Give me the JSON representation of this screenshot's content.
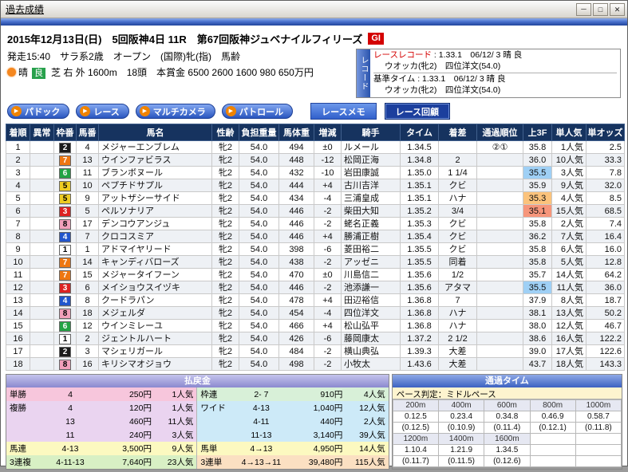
{
  "window": {
    "title": "過去成績",
    "minimize": "－",
    "maximize": "□",
    "close": "✕"
  },
  "icons": {
    "play": "▶"
  },
  "race": {
    "title": "2015年12月13日(日)　5回阪神4日 11R　第67回阪神ジュベナイルフィリーズ",
    "grade": "GI",
    "conditions": "発走15:40　サラ系2歳　オープン　(国際)牝(指)　馬齢",
    "weather": "晴",
    "going": "良",
    "course": "芝 右 外 1600m　18頭　本賞金 6500 2600 1600 980 650万円",
    "record": {
      "tab": "レコード",
      "race_record_label": "レースレコード",
      "race_record_value": " : 1.33.1　06/12/ 3 晴 良",
      "race_record_holder": "ウオッカ(牝2)　四位洋文(54.0)",
      "base_time_label": "基準タイム",
      "base_time_value": " : 1.33.1　06/12/ 3 晴 良",
      "base_time_holder": "ウオッカ(牝2)　四位洋文(54.0)"
    }
  },
  "buttons": {
    "paddock": "パドック",
    "race": "レース",
    "multi_camera": "マルチカメラ",
    "patrol": "パトロール",
    "race_memo": "レースメモ",
    "race_review": "レース回顧"
  },
  "waku_colors": {
    "1": {
      "bg": "#ffffff",
      "fg": "#000000"
    },
    "2": {
      "bg": "#1a1a1a",
      "fg": "#ffffff"
    },
    "3": {
      "bg": "#dd2222",
      "fg": "#ffffff"
    },
    "4": {
      "bg": "#2255cc",
      "fg": "#ffffff"
    },
    "5": {
      "bg": "#eecc22",
      "fg": "#000000"
    },
    "6": {
      "bg": "#22a344",
      "fg": "#ffffff"
    },
    "7": {
      "bg": "#ee7711",
      "fg": "#ffffff"
    },
    "8": {
      "bg": "#f2a0bb",
      "fg": "#000000"
    }
  },
  "results": {
    "headers": [
      "着順",
      "異常",
      "枠番",
      "馬番",
      "馬名",
      "性齢",
      "負担重量",
      "馬体重",
      "増減",
      "騎手",
      "タイム",
      "着差",
      "通過順位",
      "上3F",
      "単人気",
      "単オッズ"
    ],
    "rows": [
      {
        "pos": "1",
        "abnormal": "",
        "waku": "2",
        "num": "4",
        "name": "メジャーエンブレム",
        "sex_age": "牝2",
        "weight": "54.0",
        "horse_weight": "494",
        "weight_diff": "±0",
        "jockey": "ルメール",
        "time": "1.34.5",
        "margin": "",
        "passing": "②①",
        "last3f": "35.8",
        "last3f_hl": 0,
        "pop": "1人気",
        "odds": "2.5"
      },
      {
        "pos": "2",
        "abnormal": "",
        "waku": "7",
        "num": "13",
        "name": "ウインファビラス",
        "sex_age": "牝2",
        "weight": "54.0",
        "horse_weight": "448",
        "weight_diff": "-12",
        "jockey": "松岡正海",
        "time": "1.34.8",
        "margin": "2",
        "passing": "",
        "last3f": "36.0",
        "last3f_hl": 0,
        "pop": "10人気",
        "odds": "33.3"
      },
      {
        "pos": "3",
        "abnormal": "",
        "waku": "6",
        "num": "11",
        "name": "ブランボヌール",
        "sex_age": "牝2",
        "weight": "54.0",
        "horse_weight": "432",
        "weight_diff": "-10",
        "jockey": "岩田康誠",
        "time": "1.35.0",
        "margin": "1 1/4",
        "passing": "",
        "last3f": "35.5",
        "last3f_hl": 3,
        "pop": "3人気",
        "odds": "7.8"
      },
      {
        "pos": "4",
        "abnormal": "",
        "waku": "5",
        "num": "10",
        "name": "ペプチドサプル",
        "sex_age": "牝2",
        "weight": "54.0",
        "horse_weight": "444",
        "weight_diff": "+4",
        "jockey": "古川吉洋",
        "time": "1.35.1",
        "margin": "クビ",
        "passing": "",
        "last3f": "35.9",
        "last3f_hl": 0,
        "pop": "9人気",
        "odds": "32.0"
      },
      {
        "pos": "5",
        "abnormal": "",
        "waku": "5",
        "num": "9",
        "name": "アットザシーサイド",
        "sex_age": "牝2",
        "weight": "54.0",
        "horse_weight": "434",
        "weight_diff": "-4",
        "jockey": "三浦皇成",
        "time": "1.35.1",
        "margin": "ハナ",
        "passing": "",
        "last3f": "35.3",
        "last3f_hl": 2,
        "pop": "4人気",
        "odds": "8.5"
      },
      {
        "pos": "6",
        "abnormal": "",
        "waku": "3",
        "num": "5",
        "name": "ペルソナリア",
        "sex_age": "牝2",
        "weight": "54.0",
        "horse_weight": "446",
        "weight_diff": "-2",
        "jockey": "柴田大知",
        "time": "1.35.2",
        "margin": "3/4",
        "passing": "",
        "last3f": "35.1",
        "last3f_hl": 1,
        "pop": "15人気",
        "odds": "68.5"
      },
      {
        "pos": "7",
        "abnormal": "",
        "waku": "8",
        "num": "17",
        "name": "デンコウアンジュ",
        "sex_age": "牝2",
        "weight": "54.0",
        "horse_weight": "446",
        "weight_diff": "-2",
        "jockey": "蛯名正義",
        "time": "1.35.3",
        "margin": "クビ",
        "passing": "",
        "last3f": "35.8",
        "last3f_hl": 0,
        "pop": "2人気",
        "odds": "7.4"
      },
      {
        "pos": "8",
        "abnormal": "",
        "waku": "4",
        "num": "7",
        "name": "クロコスミア",
        "sex_age": "牝2",
        "weight": "54.0",
        "horse_weight": "446",
        "weight_diff": "+4",
        "jockey": "勝浦正樹",
        "time": "1.35.4",
        "margin": "クビ",
        "passing": "",
        "last3f": "36.2",
        "last3f_hl": 0,
        "pop": "7人気",
        "odds": "16.4"
      },
      {
        "pos": "9",
        "abnormal": "",
        "waku": "1",
        "num": "1",
        "name": "アドマイヤリード",
        "sex_age": "牝2",
        "weight": "54.0",
        "horse_weight": "398",
        "weight_diff": "-6",
        "jockey": "菱田裕二",
        "time": "1.35.5",
        "margin": "クビ",
        "passing": "",
        "last3f": "35.8",
        "last3f_hl": 0,
        "pop": "6人気",
        "odds": "16.0"
      },
      {
        "pos": "10",
        "abnormal": "",
        "waku": "7",
        "num": "14",
        "name": "キャンディバローズ",
        "sex_age": "牝2",
        "weight": "54.0",
        "horse_weight": "438",
        "weight_diff": "-2",
        "jockey": "アッゼニ",
        "time": "1.35.5",
        "margin": "同着",
        "passing": "",
        "last3f": "35.8",
        "last3f_hl": 0,
        "pop": "5人気",
        "odds": "12.8"
      },
      {
        "pos": "11",
        "abnormal": "",
        "waku": "7",
        "num": "15",
        "name": "メジャータイフーン",
        "sex_age": "牝2",
        "weight": "54.0",
        "horse_weight": "470",
        "weight_diff": "±0",
        "jockey": "川島信二",
        "time": "1.35.6",
        "margin": "1/2",
        "passing": "",
        "last3f": "35.7",
        "last3f_hl": 0,
        "pop": "14人気",
        "odds": "64.2"
      },
      {
        "pos": "12",
        "abnormal": "",
        "waku": "3",
        "num": "6",
        "name": "メイショウスイヅキ",
        "sex_age": "牝2",
        "weight": "54.0",
        "horse_weight": "446",
        "weight_diff": "-2",
        "jockey": "池添謙一",
        "time": "1.35.6",
        "margin": "アタマ",
        "passing": "",
        "last3f": "35.5",
        "last3f_hl": 3,
        "pop": "11人気",
        "odds": "36.0"
      },
      {
        "pos": "13",
        "abnormal": "",
        "waku": "4",
        "num": "8",
        "name": "クードラパン",
        "sex_age": "牝2",
        "weight": "54.0",
        "horse_weight": "478",
        "weight_diff": "+4",
        "jockey": "田辺裕信",
        "time": "1.36.8",
        "margin": "7",
        "passing": "",
        "last3f": "37.9",
        "last3f_hl": 0,
        "pop": "8人気",
        "odds": "18.7"
      },
      {
        "pos": "14",
        "abnormal": "",
        "waku": "8",
        "num": "18",
        "name": "メジェルダ",
        "sex_age": "牝2",
        "weight": "54.0",
        "horse_weight": "454",
        "weight_diff": "-4",
        "jockey": "四位洋文",
        "time": "1.36.8",
        "margin": "ハナ",
        "passing": "",
        "last3f": "38.1",
        "last3f_hl": 0,
        "pop": "13人気",
        "odds": "50.2"
      },
      {
        "pos": "15",
        "abnormal": "",
        "waku": "6",
        "num": "12",
        "name": "ウインミレーユ",
        "sex_age": "牝2",
        "weight": "54.0",
        "horse_weight": "466",
        "weight_diff": "+4",
        "jockey": "松山弘平",
        "time": "1.36.8",
        "margin": "ハナ",
        "passing": "",
        "last3f": "38.0",
        "last3f_hl": 0,
        "pop": "12人気",
        "odds": "46.7"
      },
      {
        "pos": "16",
        "abnormal": "",
        "waku": "1",
        "num": "2",
        "name": "ジェントルハート",
        "sex_age": "牝2",
        "weight": "54.0",
        "horse_weight": "426",
        "weight_diff": "-6",
        "jockey": "藤岡康太",
        "time": "1.37.2",
        "margin": "2 1/2",
        "passing": "",
        "last3f": "38.6",
        "last3f_hl": 0,
        "pop": "16人気",
        "odds": "122.2"
      },
      {
        "pos": "17",
        "abnormal": "",
        "waku": "2",
        "num": "3",
        "name": "マシェリガール",
        "sex_age": "牝2",
        "weight": "54.0",
        "horse_weight": "484",
        "weight_diff": "-2",
        "jockey": "横山典弘",
        "time": "1.39.3",
        "margin": "大差",
        "passing": "",
        "last3f": "39.0",
        "last3f_hl": 0,
        "pop": "17人気",
        "odds": "122.6"
      },
      {
        "pos": "18",
        "abnormal": "",
        "waku": "8",
        "num": "16",
        "name": "キリシマオジョウ",
        "sex_age": "牝2",
        "weight": "54.0",
        "horse_weight": "498",
        "weight_diff": "-2",
        "jockey": "小牧太",
        "time": "1.43.6",
        "margin": "大差",
        "passing": "",
        "last3f": "43.7",
        "last3f_hl": 0,
        "pop": "18人気",
        "odds": "143.3"
      }
    ]
  },
  "payout": {
    "title": "払戻金",
    "left": [
      {
        "type": "単勝",
        "combo": "4",
        "amount": "250円",
        "pop": "1人気",
        "bg": "#f7c6dc"
      },
      {
        "type": "複勝",
        "combo": "4",
        "amount": "120円",
        "pop": "1人気",
        "bg": "#ead4f0"
      },
      {
        "type": "",
        "combo": "13",
        "amount": "460円",
        "pop": "11人気",
        "bg": "#ead4f0"
      },
      {
        "type": "",
        "combo": "11",
        "amount": "240円",
        "pop": "3人気",
        "bg": "#ead4f0"
      },
      {
        "type": "馬連",
        "combo": "4-13",
        "amount": "3,500円",
        "pop": "9人気",
        "bg": "#fcf9c0"
      },
      {
        "type": "3連複",
        "combo": "4-11-13",
        "amount": "7,640円",
        "pop": "23人気",
        "bg": "#d8f0c4"
      }
    ],
    "right": [
      {
        "type": "枠連",
        "combo": "2- 7",
        "amount": "910円",
        "pop": "4人気",
        "bg": "#d8f0d8"
      },
      {
        "type": "ワイド",
        "combo": "4-13",
        "amount": "1,040円",
        "pop": "12人気",
        "bg": "#cdeaf8"
      },
      {
        "type": "",
        "combo": "4-11",
        "amount": "440円",
        "pop": "2人気",
        "bg": "#cdeaf8"
      },
      {
        "type": "",
        "combo": "11-13",
        "amount": "3,140円",
        "pop": "39人気",
        "bg": "#cdeaf8"
      },
      {
        "type": "馬単",
        "combo": "4→13",
        "amount": "4,950円",
        "pop": "14人気",
        "bg": "#fcf9c0"
      },
      {
        "type": "3連単",
        "combo": "4→13→11",
        "amount": "39,480円",
        "pop": "115人気",
        "bg": "#fbe0c2"
      }
    ]
  },
  "passing_time": {
    "title": "通過タイム",
    "pace": "ペース判定：ミドルペース",
    "segments": [
      {
        "dist": "200m",
        "time": "0.12.5",
        "lap": "(0.12.5)"
      },
      {
        "dist": "400m",
        "time": "0.23.4",
        "lap": "(0.10.9)"
      },
      {
        "dist": "600m",
        "time": "0.34.8",
        "lap": "(0.11.4)"
      },
      {
        "dist": "800m",
        "time": "0.46.9",
        "lap": "(0.12.1)"
      },
      {
        "dist": "1000m",
        "time": "0.58.7",
        "lap": "(0.11.8)"
      },
      {
        "dist": "1200m",
        "time": "1.10.4",
        "lap": "(0.11.7)"
      },
      {
        "dist": "1400m",
        "time": "1.21.9",
        "lap": "(0.11.5)"
      },
      {
        "dist": "1600m",
        "time": "1.34.5",
        "lap": "(0.12.6)"
      }
    ]
  }
}
